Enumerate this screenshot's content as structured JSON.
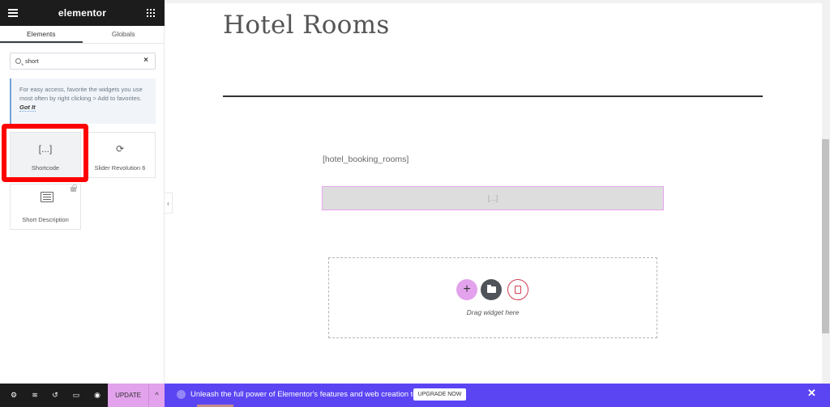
{
  "panel": {
    "brand": "elementor",
    "tabs": [
      "Elements",
      "Globals"
    ],
    "search": {
      "value": "short",
      "clear": "×"
    },
    "tip": {
      "text": "For easy access, favorite the widgets you use most often by right clicking > Add to favorites.",
      "got_it": "Got It"
    },
    "widgets": [
      {
        "label": "Shortcode",
        "icon": "shortcode-icon",
        "glyph": "[...]"
      },
      {
        "label": "Slider Revolution 6",
        "icon": "refresh-icon",
        "glyph": "⟳"
      },
      {
        "label": "Short Description",
        "icon": "description-icon"
      }
    ],
    "collapse_glyph": "‹",
    "footer": {
      "update_label": "UPDATE",
      "caret": "^"
    }
  },
  "canvas": {
    "title": "Hotel Rooms",
    "shortcode_text": "[hotel_booking_rooms]",
    "shortcode_placeholder": "[...]",
    "add_glyph": "+",
    "drag_text": "Drag widget here"
  },
  "banner": {
    "text": "Unleash the full power of Elementor's features and web creation tools.",
    "button": "UPGRADE NOW",
    "close": "✕"
  },
  "colors": {
    "accent": "#e2a2ec",
    "banner": "#5b45f3",
    "highlight": "#ff0000",
    "dark": "#1c1c1c"
  }
}
